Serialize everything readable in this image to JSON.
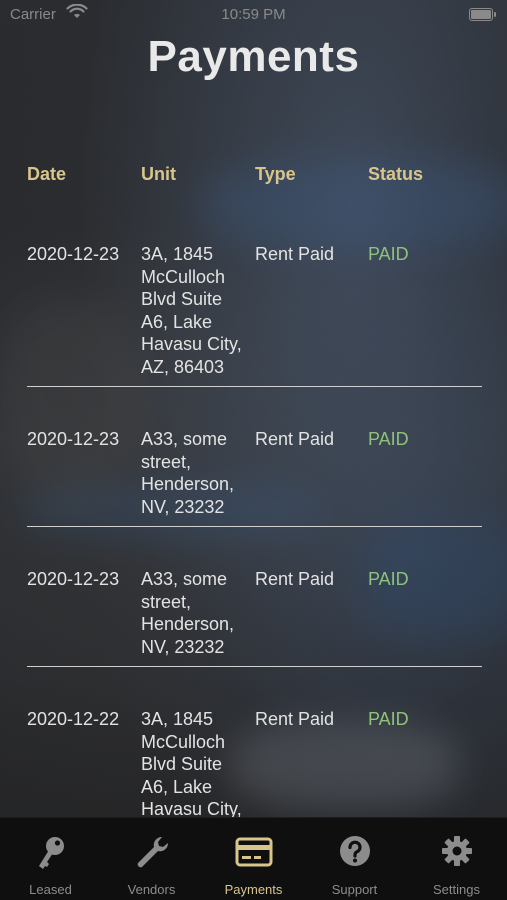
{
  "status_bar": {
    "carrier": "Carrier",
    "time": "10:59 PM"
  },
  "header": {
    "title": "Payments"
  },
  "table": {
    "columns": [
      "Date",
      "Unit",
      "Type",
      "Status"
    ],
    "rows": [
      {
        "date": "2020-12-23",
        "unit": "3A, 1845 McCulloch Blvd Suite A6, Lake Havasu City, AZ, 86403",
        "type": "Rent Paid",
        "status": "PAID"
      },
      {
        "date": "2020-12-23",
        "unit": "A33, some street, Henderson, NV, 23232",
        "type": "Rent Paid",
        "status": "PAID"
      },
      {
        "date": "2020-12-23",
        "unit": "A33, some street, Henderson, NV, 23232",
        "type": "Rent Paid",
        "status": "PAID"
      },
      {
        "date": "2020-12-22",
        "unit": "3A, 1845 McCulloch Blvd Suite A6, Lake Havasu City,",
        "type": "Rent Paid",
        "status": "PAID"
      }
    ]
  },
  "tabbar": {
    "tabs": [
      {
        "label": "Leased",
        "icon": "key-icon",
        "active": false
      },
      {
        "label": "Vendors",
        "icon": "wrench-icon",
        "active": false
      },
      {
        "label": "Payments",
        "icon": "credit-card-icon",
        "active": true
      },
      {
        "label": "Support",
        "icon": "question-circle-icon",
        "active": false
      },
      {
        "label": "Settings",
        "icon": "gear-icon",
        "active": false
      }
    ]
  },
  "colors": {
    "accent": "#d8c58c",
    "paid": "#8fc27a",
    "inactive_tab": "#8c8c8c"
  }
}
